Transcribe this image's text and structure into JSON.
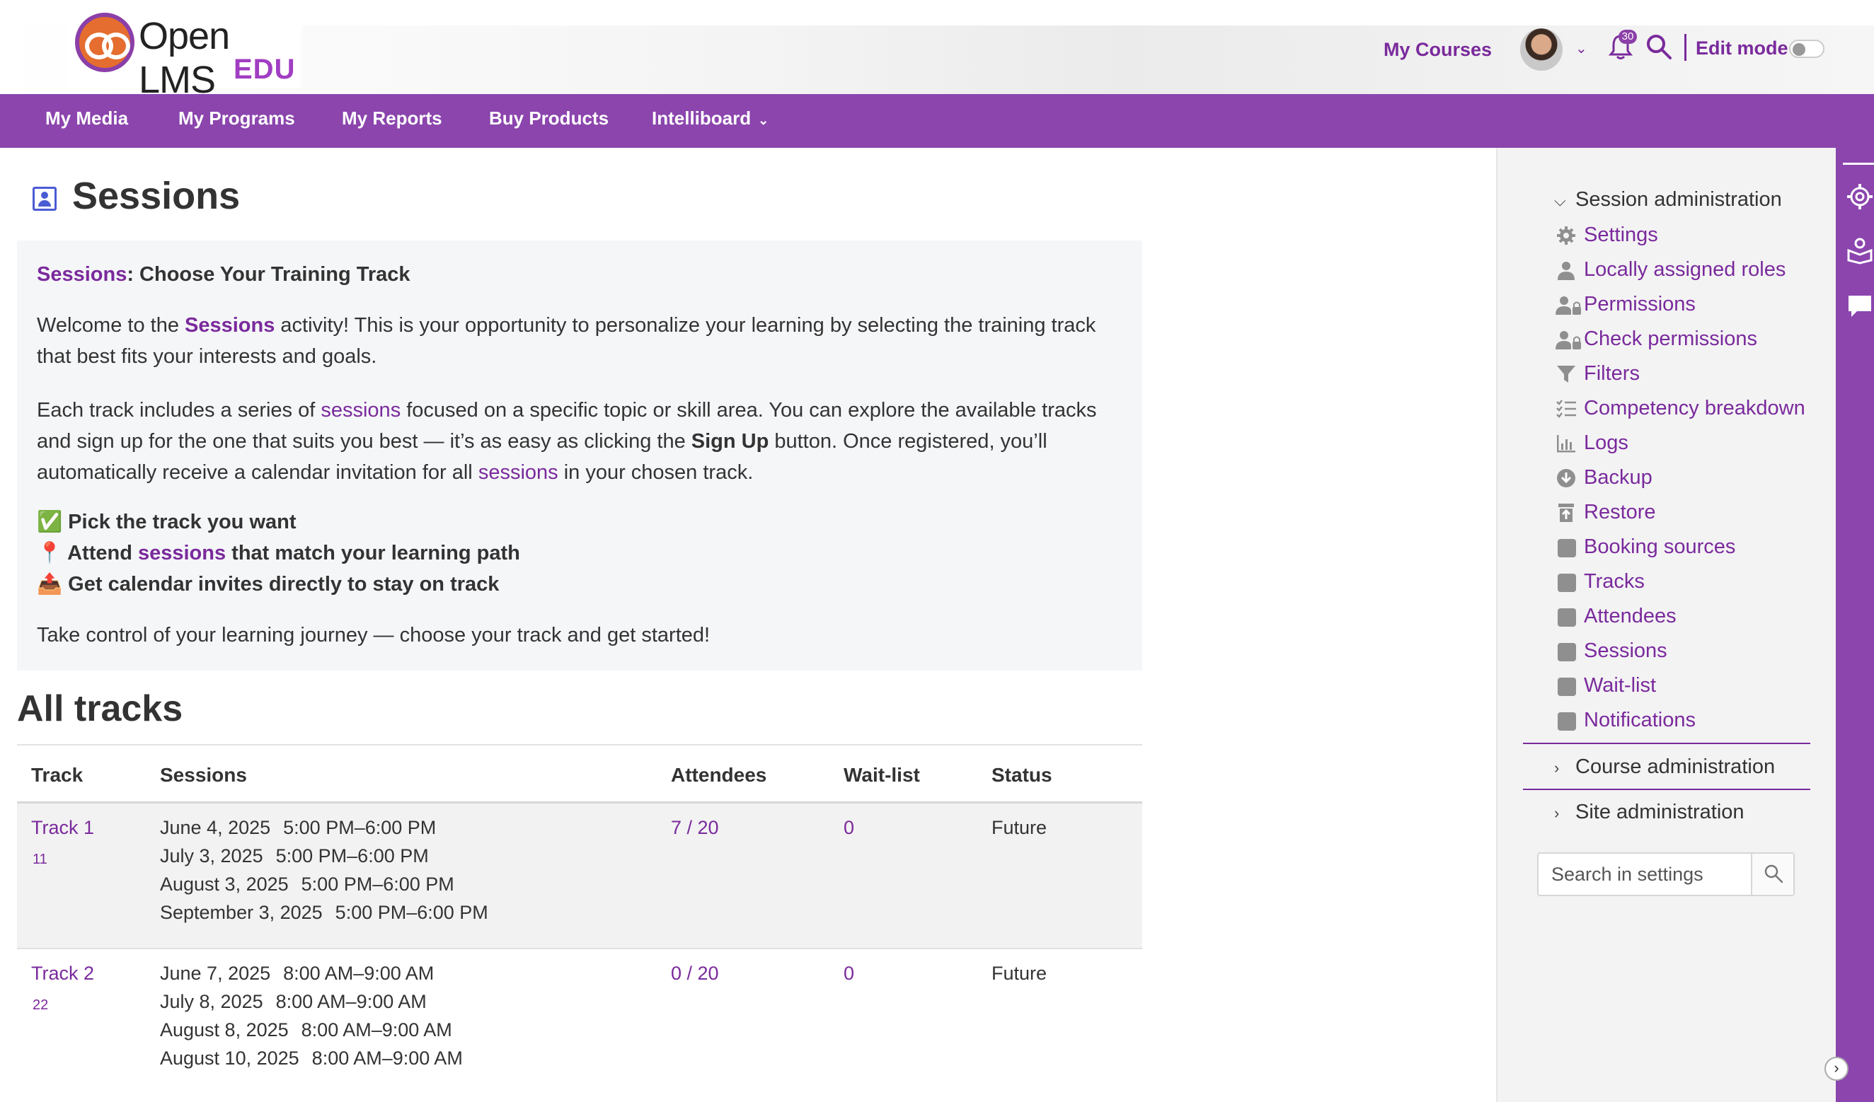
{
  "header": {
    "logo_text": "Open LMS",
    "logo_sub": "EDU",
    "my_courses": "My Courses",
    "notification_count": "30",
    "edit_mode": "Edit mode"
  },
  "nav": {
    "items": [
      {
        "label": "My Media"
      },
      {
        "label": "My Programs"
      },
      {
        "label": "My Reports"
      },
      {
        "label": "Buy Products"
      },
      {
        "label": "Intelliboard"
      }
    ]
  },
  "page": {
    "title": "Sessions"
  },
  "intro": {
    "heading_link": "Sessions",
    "heading_rest": ": Choose Your Training Track",
    "p1_a": "Welcome to the ",
    "p1_link": "Sessions",
    "p1_b": " activity! This is your opportunity to personalize your learning by selecting the training track that best fits your interests and goals.",
    "p2_a": "Each track includes a series of ",
    "p2_link1": "sessions",
    "p2_b": " focused on a specific topic or skill area. You can explore the available tracks and sign up for the one that suits you best — it’s as easy as clicking the ",
    "p2_bold": "Sign Up",
    "p2_c": " button. Once registered, you’ll automatically receive a calendar invitation for all ",
    "p2_link2": "sessions",
    "p2_d": " in your chosen track.",
    "bullet1_icon": "✅",
    "bullet1": "Pick the track you want",
    "bullet2_icon": "📍",
    "bullet2_a": "Attend ",
    "bullet2_link": "sessions",
    "bullet2_b": " that match your learning path",
    "bullet3_icon": "📤",
    "bullet3": "Get calendar invites directly to stay on track",
    "closing": "Take control of your learning journey — choose your track and get started!"
  },
  "tracks": {
    "heading": "All tracks",
    "columns": [
      "Track",
      "Sessions",
      "Attendees",
      "Wait-list",
      "Status"
    ],
    "rows": [
      {
        "name": "Track 1",
        "sub": "11",
        "sessions": [
          {
            "date": "June 4, 2025",
            "time": "5:00 PM–6:00 PM"
          },
          {
            "date": "July 3, 2025",
            "time": "5:00 PM–6:00 PM"
          },
          {
            "date": "August 3, 2025",
            "time": "5:00 PM–6:00 PM"
          },
          {
            "date": "September 3, 2025",
            "time": "5:00 PM–6:00 PM"
          }
        ],
        "attendees": "7 / 20",
        "waitlist": "0",
        "status": "Future"
      },
      {
        "name": "Track 2",
        "sub": "22",
        "sessions": [
          {
            "date": "June 7, 2025",
            "time": "8:00 AM–9:00 AM"
          },
          {
            "date": "July 8, 2025",
            "time": "8:00 AM–9:00 AM"
          },
          {
            "date": "August 8, 2025",
            "time": "8:00 AM–9:00 AM"
          },
          {
            "date": "August 10, 2025",
            "time": "8:00 AM–9:00 AM"
          }
        ],
        "attendees": "0 / 20",
        "waitlist": "0",
        "status": "Future"
      }
    ]
  },
  "drawer": {
    "session_admin": "Session administration",
    "items": [
      {
        "label": "Settings",
        "icon": "gear-icon"
      },
      {
        "label": "Locally assigned roles",
        "icon": "user-icon"
      },
      {
        "label": "Permissions",
        "icon": "user-lock-icon"
      },
      {
        "label": "Check permissions",
        "icon": "user-lock-icon"
      },
      {
        "label": "Filters",
        "icon": "filter-icon"
      },
      {
        "label": "Competency breakdown",
        "icon": "checklist-icon"
      },
      {
        "label": "Logs",
        "icon": "chart-icon"
      },
      {
        "label": "Backup",
        "icon": "download-icon"
      },
      {
        "label": "Restore",
        "icon": "restore-icon"
      },
      {
        "label": "Booking sources",
        "icon": "square-icon"
      },
      {
        "label": "Tracks",
        "icon": "square-icon"
      },
      {
        "label": "Attendees",
        "icon": "square-icon"
      },
      {
        "label": "Sessions",
        "icon": "square-icon"
      },
      {
        "label": "Wait-list",
        "icon": "square-icon"
      },
      {
        "label": "Notifications",
        "icon": "square-icon"
      }
    ],
    "course_admin": "Course administration",
    "site_admin": "Site administration",
    "search_placeholder": "Search in settings"
  },
  "colors": {
    "brand": "#8b45ad",
    "link": "#7a2a9c"
  }
}
